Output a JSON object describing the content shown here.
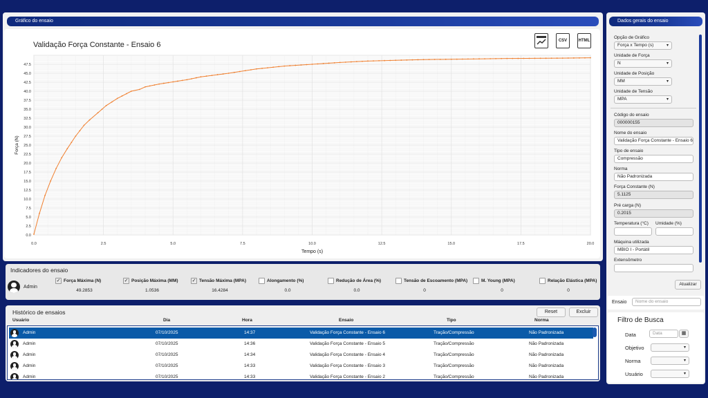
{
  "graph_panel": {
    "title": "Gráfico do ensaio"
  },
  "chart_title": "Validação Força Constante - Ensaio 6",
  "toolbar": {
    "image_icon": "chart-image-icon",
    "csv_label": "CSV",
    "html_label": "HTML"
  },
  "chart_data": {
    "type": "line",
    "xlabel": "Tempo (s)",
    "ylabel": "Força (N)",
    "xlim": [
      0,
      20
    ],
    "ylim": [
      0,
      50
    ],
    "x_ticks": [
      "0.0",
      "2.5",
      "5.0",
      "7.5",
      "10.0",
      "12.5",
      "15.0",
      "17.5",
      "20.0"
    ],
    "y_ticks": [
      "0.0",
      "2.5",
      "5.0",
      "7.5",
      "10.0",
      "12.5",
      "15.0",
      "17.5",
      "20.0",
      "22.5",
      "25.0",
      "27.5",
      "30.0",
      "32.5",
      "35.0",
      "37.5",
      "40.0",
      "42.5",
      "45.0",
      "47.5"
    ],
    "grid": true,
    "color": "#f08030",
    "x": [
      0,
      0.2,
      0.4,
      0.6,
      0.8,
      1.0,
      1.2,
      1.5,
      1.8,
      2.0,
      2.3,
      2.6,
      3.0,
      3.5,
      3.8,
      4.0,
      4.5,
      5.0,
      5.5,
      6.0,
      7.0,
      8.0,
      9.0,
      10.0,
      11.0,
      12.0,
      13.0,
      14.0,
      15.0,
      16.0,
      17.0,
      18.0,
      19.0,
      20.0
    ],
    "y": [
      0.2,
      6.0,
      11.0,
      15.0,
      18.5,
      21.5,
      24.0,
      27.5,
      30.5,
      32.0,
      34.0,
      36.0,
      38.0,
      40.0,
      40.5,
      41.2,
      42.0,
      42.6,
      43.2,
      44.0,
      45.0,
      46.2,
      47.0,
      47.5,
      48.0,
      48.4,
      48.6,
      48.8,
      48.9,
      49.0,
      49.1,
      49.15,
      49.2,
      49.3
    ]
  },
  "indicators": {
    "title": "Indicadores do ensaio",
    "user": "Admin",
    "items": [
      {
        "label": "Força Máxima (N)",
        "value": "49.2853",
        "checked": true
      },
      {
        "label": "Posição Máxima (MM)",
        "value": "1.0536",
        "checked": true
      },
      {
        "label": "Tensão Máxima (MPA)",
        "value": "16.4284",
        "checked": true
      },
      {
        "label": "Alongamento (%)",
        "value": "0.0",
        "checked": false
      },
      {
        "label": "Redução de Área (%)",
        "value": "0.0",
        "checked": false
      },
      {
        "label": "Tensão de Escoamento (MPA)",
        "value": "0",
        "checked": false
      },
      {
        "label": "M. Young (MPA)",
        "value": "0",
        "checked": false
      },
      {
        "label": "Relação Elástica (MPA)",
        "value": "0",
        "checked": false
      }
    ]
  },
  "history": {
    "title": "Histórico de ensaios",
    "reset_label": "Reset",
    "delete_label": "Excluir",
    "columns": [
      "Usuário",
      "Dia",
      "Hora",
      "Ensaio",
      "Tipo",
      "Norma"
    ],
    "rows": [
      [
        "Admin",
        "07/10/2025",
        "14:37",
        "Validação Força Constante - Ensaio 6",
        "Tração/Compressão",
        "Não Padronizada"
      ],
      [
        "Admin",
        "07/10/2025",
        "14:36",
        "Validação Força Constante - Ensaio 5",
        "Tração/Compressão",
        "Não Padronizada"
      ],
      [
        "Admin",
        "07/10/2025",
        "14:34",
        "Validação Força Constante - Ensaio 4",
        "Tração/Compressão",
        "Não Padronizada"
      ],
      [
        "Admin",
        "07/10/2025",
        "14:33",
        "Validação Força Constante - Ensaio 3",
        "Tração/Compressão",
        "Não Padronizada"
      ],
      [
        "Admin",
        "07/10/2025",
        "14:33",
        "Validação Força Constante - Ensaio 2",
        "Tração/Compressão",
        "Não Padronizada"
      ]
    ]
  },
  "side": {
    "title": "Dados gerais do ensaio",
    "grafico_label": "Opção de Gráfico",
    "grafico_value": "Força x Tempo (s)",
    "forca_label": "Unidade de Força",
    "forca_value": "N",
    "posicao_label": "Unidade de Posição",
    "posicao_value": "MM",
    "tensao_label": "Unidade de Tensão",
    "tensao_value": "MPA",
    "codigo_label": "Código do ensaio",
    "codigo_value": "000000155",
    "nome_label": "Nome do ensaio",
    "nome_value": "Validação Força Constante - Ensaio 6",
    "tipo_label": "Tipo de ensaio",
    "tipo_value": "Compressão",
    "norma_label": "Norma",
    "norma_value": "Não Padronizada",
    "forca_const_label": "Força Constante (N)",
    "forca_const_value": "5.1125",
    "precarga_label": "Pré carga (N)",
    "precarga_value": "0.2015",
    "temp_label": "Temperatura (°C)",
    "umidade_label": "Umidade (%)",
    "maquina_label": "Máquina utilizada",
    "maquina_value": "MBIO I - Portátil",
    "extensometro_label": "Extensômetro",
    "update_label": "Atualizar",
    "ensaio_label": "Ensaio",
    "ensaio_placeholder": "Nome do ensaio",
    "filter_title": "Filtro de Busca",
    "data_label": "Data",
    "data_placeholder": "Data",
    "objetivo_label": "Objetivo",
    "norma_filter_label": "Norma",
    "usuario_label": "Usuário"
  }
}
